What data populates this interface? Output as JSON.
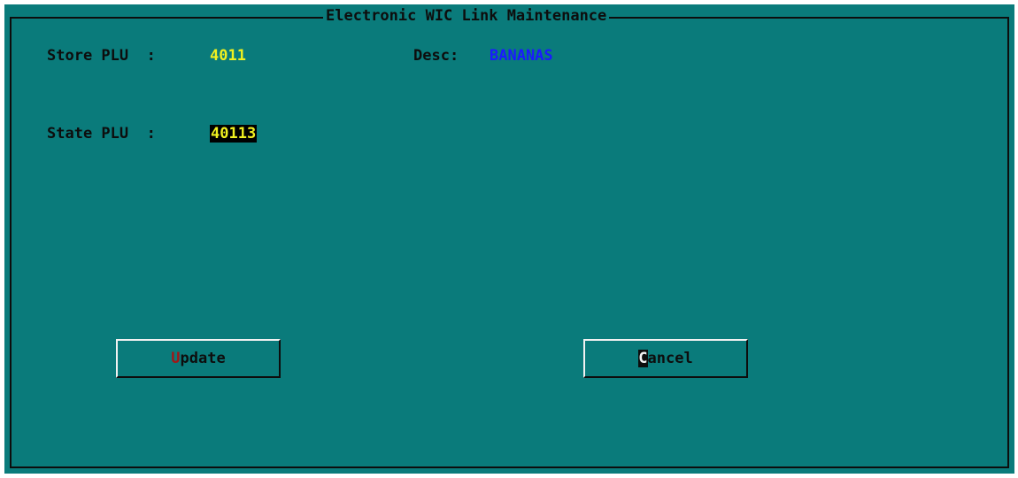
{
  "window": {
    "title": "Electronic WIC Link Maintenance"
  },
  "fields": {
    "store_plu_label": "Store PLU  :",
    "store_plu_value": "4011",
    "desc_label": "Desc:",
    "desc_value": "BANANAS",
    "state_plu_label": "State PLU  :",
    "state_plu_value": "40113"
  },
  "buttons": {
    "update": {
      "hotkey": "U",
      "rest": "pdate"
    },
    "cancel": {
      "hotkey": "C",
      "rest": "ancel"
    }
  },
  "colors": {
    "background": "#0a7b7b",
    "label": "#0d0d0d",
    "value": "#f0f020",
    "description": "#1a1aff",
    "hotkey": "#a01818"
  }
}
